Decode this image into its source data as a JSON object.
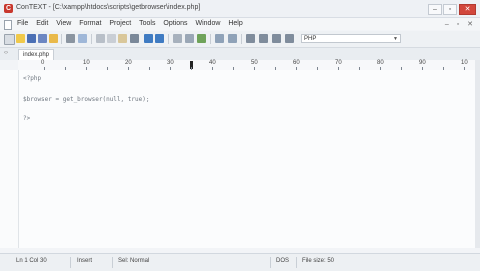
{
  "window": {
    "title": "ConTEXT - [C:\\xampp\\htdocs\\scripts\\getbrowser\\index.php]",
    "app_icon": "C",
    "minimize": "‒",
    "maximize": "▫",
    "close": "✕"
  },
  "menu": {
    "items": [
      "File",
      "Edit",
      "View",
      "Format",
      "Project",
      "Tools",
      "Options",
      "Window",
      "Help"
    ],
    "right": "‒ ▫ ✕"
  },
  "toolbar": {
    "language": "PHP"
  },
  "tabs": [
    {
      "label": "index.php"
    }
  ],
  "ruler": {
    "labels": [
      "0",
      "10",
      "20",
      "30",
      "40",
      "50",
      "60",
      "70",
      "80",
      "90",
      "10"
    ]
  },
  "editor": {
    "lines": [
      "<?php",
      "",
      "$browser = get_browser(null, true);",
      "",
      "?>"
    ]
  },
  "status": {
    "position": "Ln 1 Col 30",
    "mode": "Insert",
    "modified": "Sel: Normal",
    "encoding": "DOS",
    "filesize": "File size: 50"
  },
  "colors": {
    "close": "#d2473c",
    "app_icon": "#c8372d"
  }
}
